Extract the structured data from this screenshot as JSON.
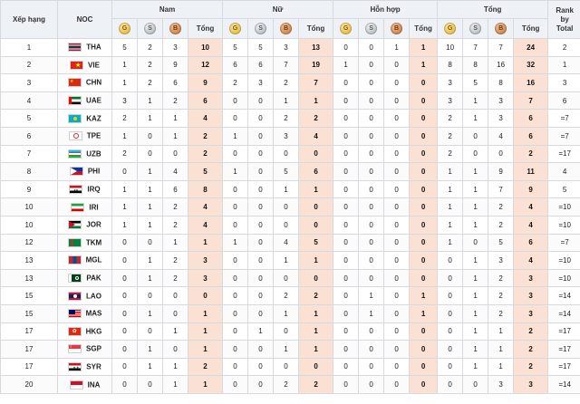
{
  "headers": {
    "rank": "Xếp hạng",
    "noc": "NOC",
    "men": "Nam",
    "women": "Nữ",
    "mixed": "Hỗn hợp",
    "total": "Tổng",
    "sub_total": "Tổng",
    "rank_by_total": [
      "Rank",
      "by",
      "Total"
    ],
    "medal_letters": {
      "gold": "G",
      "silver": "S",
      "bronze": "B"
    }
  },
  "colors": {
    "gold": "#d9a520",
    "silver": "#9ea3a8",
    "bronze": "#b5652a",
    "total_highlight": "#fbe1d4"
  },
  "rows": [
    {
      "rank": "1",
      "code": "THA",
      "flag": "thailand",
      "men": [
        "5",
        "2",
        "3",
        "10"
      ],
      "women": [
        "5",
        "5",
        "3",
        "13"
      ],
      "mixed": [
        "0",
        "0",
        "1",
        "1"
      ],
      "total": [
        "10",
        "7",
        "7",
        "24"
      ],
      "rbt": "2"
    },
    {
      "rank": "2",
      "code": "VIE",
      "flag": "vietnam",
      "men": [
        "1",
        "2",
        "9",
        "12"
      ],
      "women": [
        "6",
        "6",
        "7",
        "19"
      ],
      "mixed": [
        "1",
        "0",
        "0",
        "1"
      ],
      "total": [
        "8",
        "8",
        "16",
        "32"
      ],
      "rbt": "1"
    },
    {
      "rank": "3",
      "code": "CHN",
      "flag": "china",
      "men": [
        "1",
        "2",
        "6",
        "9"
      ],
      "women": [
        "2",
        "3",
        "2",
        "7"
      ],
      "mixed": [
        "0",
        "0",
        "0",
        "0"
      ],
      "total": [
        "3",
        "5",
        "8",
        "16"
      ],
      "rbt": "3"
    },
    {
      "rank": "4",
      "code": "UAE",
      "flag": "uae",
      "men": [
        "3",
        "1",
        "2",
        "6"
      ],
      "women": [
        "0",
        "0",
        "1",
        "1"
      ],
      "mixed": [
        "0",
        "0",
        "0",
        "0"
      ],
      "total": [
        "3",
        "1",
        "3",
        "7"
      ],
      "rbt": "6"
    },
    {
      "rank": "5",
      "code": "KAZ",
      "flag": "kazakhstan",
      "men": [
        "2",
        "1",
        "1",
        "4"
      ],
      "women": [
        "0",
        "0",
        "2",
        "2"
      ],
      "mixed": [
        "0",
        "0",
        "0",
        "0"
      ],
      "total": [
        "2",
        "1",
        "3",
        "6"
      ],
      "rbt": "=7"
    },
    {
      "rank": "6",
      "code": "TPE",
      "flag": "tpe",
      "men": [
        "1",
        "0",
        "1",
        "2"
      ],
      "women": [
        "1",
        "0",
        "3",
        "4"
      ],
      "mixed": [
        "0",
        "0",
        "0",
        "0"
      ],
      "total": [
        "2",
        "0",
        "4",
        "6"
      ],
      "rbt": "=7"
    },
    {
      "rank": "7",
      "code": "UZB",
      "flag": "uzbekistan",
      "men": [
        "2",
        "0",
        "0",
        "2"
      ],
      "women": [
        "0",
        "0",
        "0",
        "0"
      ],
      "mixed": [
        "0",
        "0",
        "0",
        "0"
      ],
      "total": [
        "2",
        "0",
        "0",
        "2"
      ],
      "rbt": "=17"
    },
    {
      "rank": "8",
      "code": "PHI",
      "flag": "philippines",
      "men": [
        "0",
        "1",
        "4",
        "5"
      ],
      "women": [
        "1",
        "0",
        "5",
        "6"
      ],
      "mixed": [
        "0",
        "0",
        "0",
        "0"
      ],
      "total": [
        "1",
        "1",
        "9",
        "11"
      ],
      "rbt": "4"
    },
    {
      "rank": "9",
      "code": "IRQ",
      "flag": "iraq",
      "men": [
        "1",
        "1",
        "6",
        "8"
      ],
      "women": [
        "0",
        "0",
        "1",
        "1"
      ],
      "mixed": [
        "0",
        "0",
        "0",
        "0"
      ],
      "total": [
        "1",
        "1",
        "7",
        "9"
      ],
      "rbt": "5"
    },
    {
      "rank": "10",
      "code": "IRI",
      "flag": "iran",
      "men": [
        "1",
        "1",
        "2",
        "4"
      ],
      "women": [
        "0",
        "0",
        "0",
        "0"
      ],
      "mixed": [
        "0",
        "0",
        "0",
        "0"
      ],
      "total": [
        "1",
        "1",
        "2",
        "4"
      ],
      "rbt": "=10"
    },
    {
      "rank": "10",
      "code": "JOR",
      "flag": "jordan",
      "men": [
        "1",
        "1",
        "2",
        "4"
      ],
      "women": [
        "0",
        "0",
        "0",
        "0"
      ],
      "mixed": [
        "0",
        "0",
        "0",
        "0"
      ],
      "total": [
        "1",
        "1",
        "2",
        "4"
      ],
      "rbt": "=10"
    },
    {
      "rank": "12",
      "code": "TKM",
      "flag": "turkmenistan",
      "men": [
        "0",
        "0",
        "1",
        "1"
      ],
      "women": [
        "1",
        "0",
        "4",
        "5"
      ],
      "mixed": [
        "0",
        "0",
        "0",
        "0"
      ],
      "total": [
        "1",
        "0",
        "5",
        "6"
      ],
      "rbt": "=7"
    },
    {
      "rank": "13",
      "code": "MGL",
      "flag": "mongolia",
      "men": [
        "0",
        "1",
        "2",
        "3"
      ],
      "women": [
        "0",
        "0",
        "1",
        "1"
      ],
      "mixed": [
        "0",
        "0",
        "0",
        "0"
      ],
      "total": [
        "0",
        "1",
        "3",
        "4"
      ],
      "rbt": "=10"
    },
    {
      "rank": "13",
      "code": "PAK",
      "flag": "pakistan",
      "men": [
        "0",
        "1",
        "2",
        "3"
      ],
      "women": [
        "0",
        "0",
        "0",
        "0"
      ],
      "mixed": [
        "0",
        "0",
        "0",
        "0"
      ],
      "total": [
        "0",
        "1",
        "2",
        "3"
      ],
      "rbt": "=10"
    },
    {
      "rank": "15",
      "code": "LAO",
      "flag": "laos",
      "men": [
        "0",
        "0",
        "0",
        "0"
      ],
      "women": [
        "0",
        "0",
        "2",
        "2"
      ],
      "mixed": [
        "0",
        "1",
        "0",
        "1"
      ],
      "total": [
        "0",
        "1",
        "2",
        "3"
      ],
      "rbt": "=14"
    },
    {
      "rank": "15",
      "code": "MAS",
      "flag": "malaysia",
      "men": [
        "0",
        "1",
        "0",
        "1"
      ],
      "women": [
        "0",
        "0",
        "1",
        "1"
      ],
      "mixed": [
        "0",
        "1",
        "0",
        "1"
      ],
      "total": [
        "0",
        "1",
        "2",
        "3"
      ],
      "rbt": "=14"
    },
    {
      "rank": "17",
      "code": "HKG",
      "flag": "hongkong",
      "men": [
        "0",
        "0",
        "1",
        "1"
      ],
      "women": [
        "0",
        "1",
        "0",
        "1"
      ],
      "mixed": [
        "0",
        "0",
        "0",
        "0"
      ],
      "total": [
        "0",
        "1",
        "1",
        "2"
      ],
      "rbt": "=17"
    },
    {
      "rank": "17",
      "code": "SGP",
      "flag": "singapore",
      "men": [
        "0",
        "1",
        "0",
        "1"
      ],
      "women": [
        "0",
        "0",
        "1",
        "1"
      ],
      "mixed": [
        "0",
        "0",
        "0",
        "0"
      ],
      "total": [
        "0",
        "1",
        "1",
        "2"
      ],
      "rbt": "=17"
    },
    {
      "rank": "17",
      "code": "SYR",
      "flag": "syria",
      "men": [
        "0",
        "1",
        "1",
        "2"
      ],
      "women": [
        "0",
        "0",
        "0",
        "0"
      ],
      "mixed": [
        "0",
        "0",
        "0",
        "0"
      ],
      "total": [
        "0",
        "1",
        "1",
        "2"
      ],
      "rbt": "=17"
    },
    {
      "rank": "20",
      "code": "INA",
      "flag": "indonesia",
      "men": [
        "0",
        "0",
        "1",
        "1"
      ],
      "women": [
        "0",
        "0",
        "2",
        "2"
      ],
      "mixed": [
        "0",
        "0",
        "0",
        "0"
      ],
      "total": [
        "0",
        "0",
        "3",
        "3"
      ],
      "rbt": "=14"
    }
  ]
}
